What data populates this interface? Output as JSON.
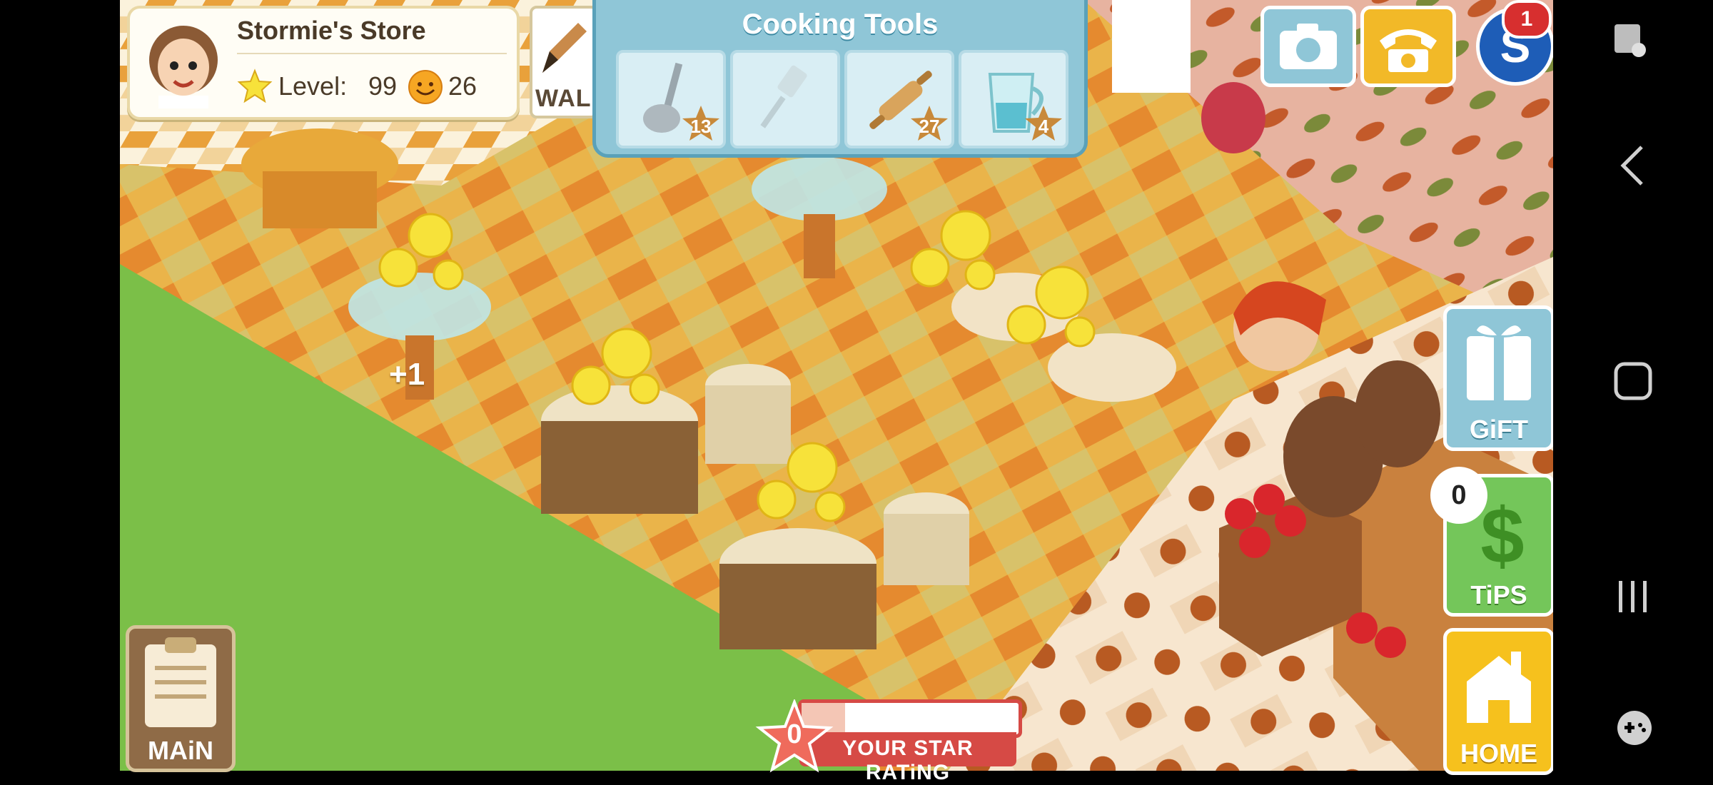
{
  "store": {
    "name": "Stormie's Store",
    "level_label": "Level:",
    "level_value": "99",
    "smiles": "26"
  },
  "wall_tab": {
    "label": "WALL"
  },
  "cooking_tools": {
    "title": "Cooking Tools",
    "items": [
      {
        "icon": "ladle-icon",
        "count": "13"
      },
      {
        "icon": "spatula-icon",
        "count": ""
      },
      {
        "icon": "rolling-pin-icon",
        "count": "27"
      },
      {
        "icon": "measuring-cup-icon",
        "count": "4"
      }
    ]
  },
  "top_right": {
    "notification_count": "1"
  },
  "buttons": {
    "gift": "GiFT",
    "tips": "TiPS",
    "tips_count": "0",
    "home": "HOME",
    "main": "MAiN"
  },
  "floating_text": {
    "plus_one": "+1"
  },
  "star_rating": {
    "value": "0",
    "label": "YOUR STAR RATiNG",
    "progress": 0.2
  },
  "colors": {
    "grass": "#7bbf48",
    "accent_blue": "#8fc6d7",
    "accent_gold": "#f6c11d",
    "rating_red": "#d64a45"
  }
}
